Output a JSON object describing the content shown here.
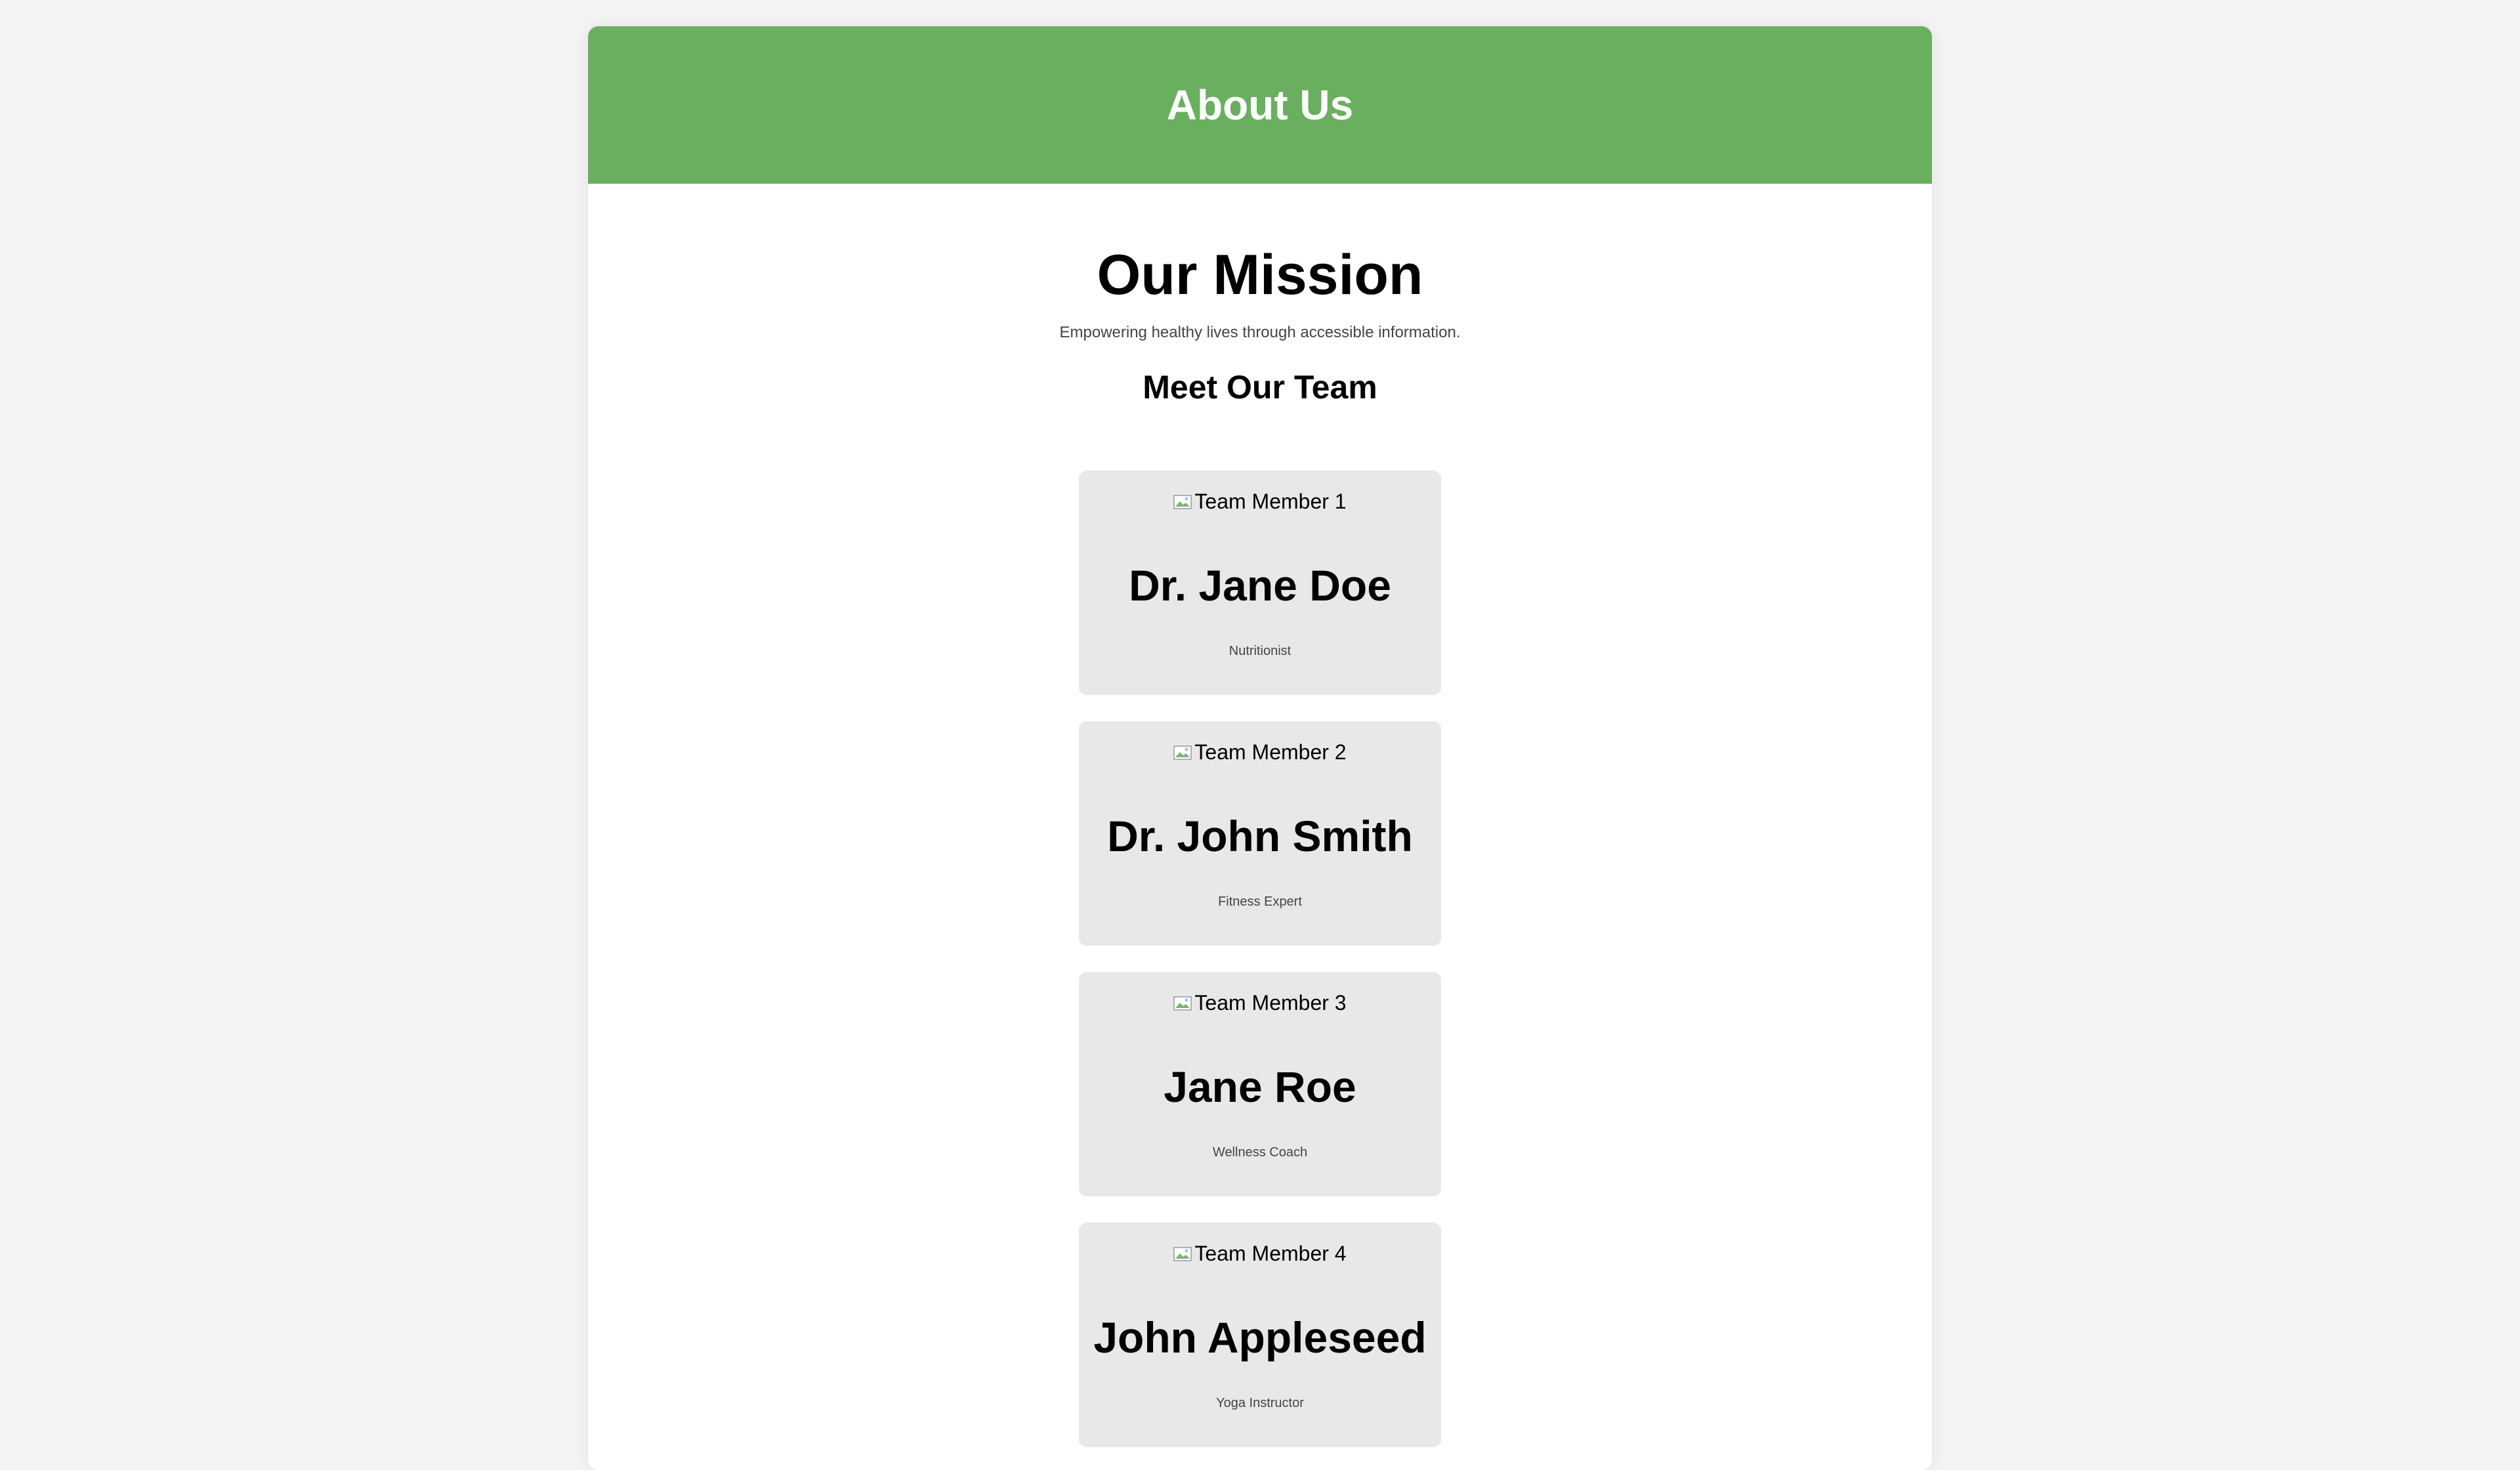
{
  "header": {
    "title": "About Us"
  },
  "mission": {
    "title": "Our Mission",
    "text": "Empowering healthy lives through accessible information."
  },
  "team": {
    "title": "Meet Our Team",
    "members": [
      {
        "image_alt": "Team Member 1",
        "name": "Dr. Jane Doe",
        "role": "Nutritionist"
      },
      {
        "image_alt": "Team Member 2",
        "name": "Dr. John Smith",
        "role": "Fitness Expert"
      },
      {
        "image_alt": "Team Member 3",
        "name": "Jane Roe",
        "role": "Wellness Coach"
      },
      {
        "image_alt": "Team Member 4",
        "name": "John Appleseed",
        "role": "Yoga Instructor"
      }
    ]
  },
  "colors": {
    "header_bg": "#6aaf5f",
    "card_bg": "#e8e8e8",
    "page_bg": "#f4f4f4"
  }
}
